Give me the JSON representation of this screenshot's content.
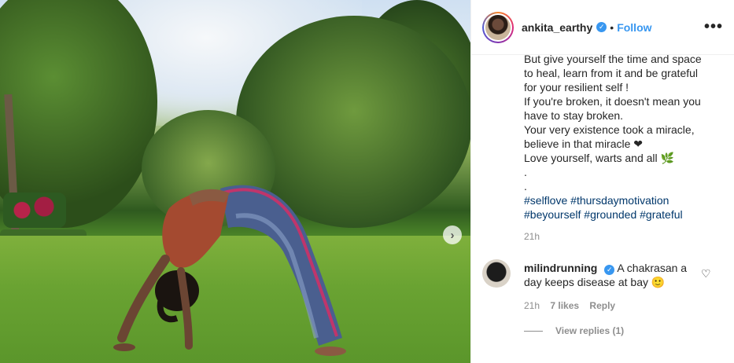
{
  "post": {
    "username": "ankita_earthy",
    "separator": "•",
    "follow_label": "Follow",
    "more_label": "•••",
    "verified_mark": "✓",
    "carousel_next": "›",
    "caption_lines": [
      "But give yourself the time and space",
      "to heal, learn from it and be grateful",
      "for your resilient self !",
      "If you're broken, it doesn't mean you",
      "have to stay broken.",
      "Your very existence took a miracle,",
      "believe in that miracle ❤",
      "Love yourself, warts and all 🌿",
      ".",
      "."
    ],
    "hashtags_line1": [
      "#selflove",
      "#thursdaymotivation"
    ],
    "hashtags_line2": [
      "#beyourself",
      "#grounded",
      "#grateful"
    ],
    "time": "21h"
  },
  "comment": {
    "username": "milindrunning",
    "text": "A chakrasan a day keeps disease at bay 🙂",
    "time": "21h",
    "likes": "7 likes",
    "reply_label": "Reply",
    "heart_icon": "♡",
    "view_replies": "View replies (1)"
  },
  "icons": {
    "verified": "verified-badge-icon",
    "more": "more-options-icon",
    "heart": "heart-icon",
    "next": "chevron-right-icon"
  },
  "colors": {
    "link_blue": "#3897f0",
    "hashtag": "#00376b",
    "muted": "#8e8e8e",
    "text": "#262626"
  }
}
